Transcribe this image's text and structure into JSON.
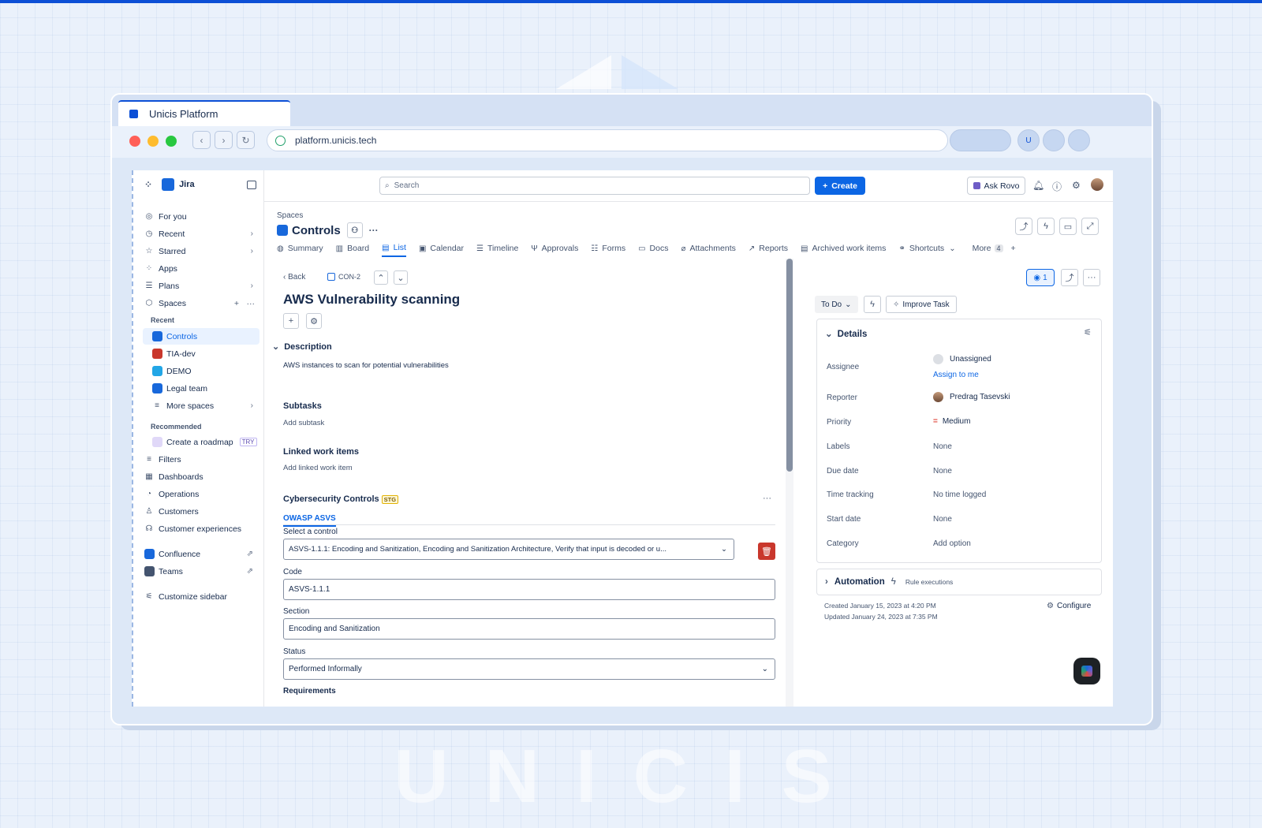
{
  "browser": {
    "tab_title": "Unicis Platform",
    "url": "platform.unicis.tech",
    "user_initial": "U"
  },
  "watermark": "UNICIS",
  "sidebar": {
    "app_name": "Jira",
    "items": [
      {
        "label": "For you",
        "icon": "user-circle-icon"
      },
      {
        "label": "Recent",
        "icon": "clock-icon"
      },
      {
        "label": "Starred",
        "icon": "star-icon"
      },
      {
        "label": "Apps",
        "icon": "apps-icon"
      },
      {
        "label": "Plans",
        "icon": "plans-icon"
      },
      {
        "label": "Spaces",
        "icon": "spaces-icon"
      }
    ],
    "recent_label": "Recent",
    "spaces": [
      {
        "label": "Controls",
        "color": "#1868db"
      },
      {
        "label": "TIA-dev",
        "color": "#c9372c"
      },
      {
        "label": "DEMO",
        "color": "#22a6e6"
      },
      {
        "label": "Legal team",
        "color": "#1868db"
      }
    ],
    "more_spaces": "More spaces",
    "recommended_label": "Recommended",
    "roadmap": "Create a roadmap",
    "try_badge": "TRY",
    "lower": [
      "Filters",
      "Dashboards",
      "Operations",
      "Customers",
      "Customer experiences"
    ],
    "external": [
      "Confluence",
      "Teams"
    ],
    "customize": "Customize sidebar"
  },
  "topbar": {
    "search_placeholder": "Search",
    "create_label": "Create",
    "ask_rovo": "Ask Rovo"
  },
  "header": {
    "breadcrumb": "Spaces",
    "title": "Controls",
    "tabs": [
      "Summary",
      "Board",
      "List",
      "Calendar",
      "Timeline",
      "Approvals",
      "Forms",
      "Docs",
      "Attachments",
      "Reports",
      "Archived work items",
      "Shortcuts",
      "More"
    ],
    "more_count": "4",
    "active_tab": "List"
  },
  "issue": {
    "back": "Back",
    "key": "CON-2",
    "title": "AWS Vulnerability scanning",
    "description_heading": "Description",
    "description": "AWS instances to scan for potential vulnerabilities",
    "subtasks_heading": "Subtasks",
    "add_subtask": "Add subtask",
    "linked_heading": "Linked work items",
    "add_linked": "Add linked work item",
    "cyber_heading": "Cybersecurity Controls",
    "stg_badge": "STG",
    "owasp_tab": "OWASP ASVS",
    "select_control_label": "Select a control",
    "select_control_value": "ASVS-1.1.1: Encoding and Sanitization, Encoding and Sanitization Architecture, Verify that input is decoded or u...",
    "code_label": "Code",
    "code_value": "ASVS-1.1.1",
    "section_label": "Section",
    "section_value": "Encoding and Sanitization",
    "status_label": "Status",
    "status_value": "Performed Informally",
    "requirements_label": "Requirements"
  },
  "panel": {
    "watch_count": "1",
    "status_button": "To Do",
    "improve_task": "Improve Task",
    "details_heading": "Details",
    "fields": [
      {
        "label": "Assignee",
        "value": "Unassigned"
      },
      {
        "label": "Reporter",
        "value": "Predrag Tasevski"
      },
      {
        "label": "Priority",
        "value": "Medium"
      },
      {
        "label": "Labels",
        "value": "None"
      },
      {
        "label": "Due date",
        "value": "None"
      },
      {
        "label": "Time tracking",
        "value": "No time logged"
      },
      {
        "label": "Start date",
        "value": "None"
      },
      {
        "label": "Category",
        "value": "Add option"
      }
    ],
    "assign_to_me": "Assign to me",
    "automation_heading": "Automation",
    "rule_executions": "Rule executions",
    "created": "Created January 15, 2023 at 4:20 PM",
    "updated": "Updated January 24, 2023 at 7:35 PM",
    "configure": "Configure"
  },
  "colors": {
    "brand": "#0c4fd6",
    "accent": "#0c66e4",
    "danger": "#c9372c",
    "priority_medium": "#e2483d"
  }
}
